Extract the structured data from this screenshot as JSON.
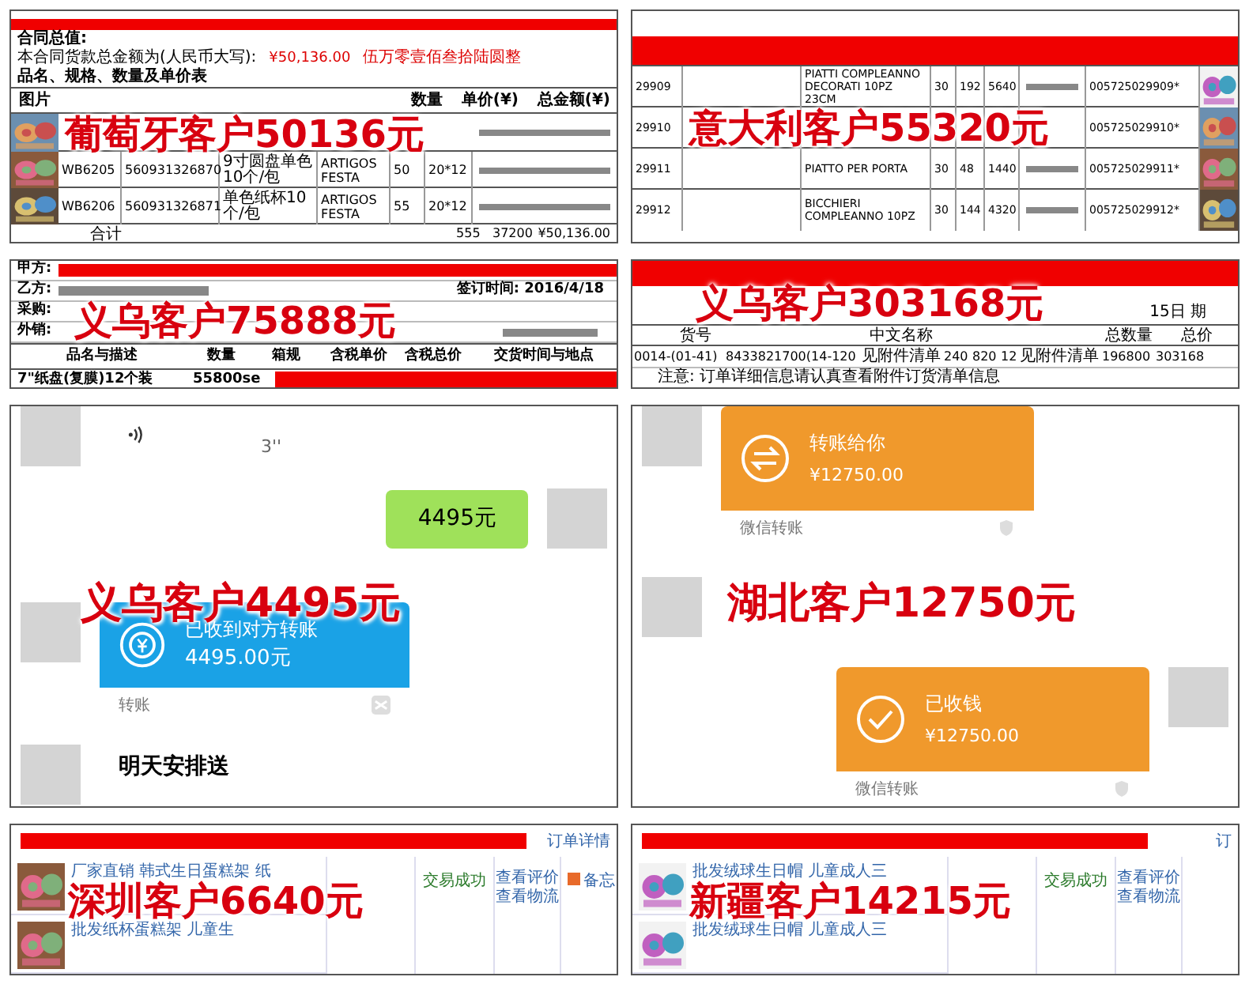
{
  "portugal": {
    "label": "葡萄牙客户50136元",
    "title": "合同总值:",
    "amount_line": "本合同货款总金额为(人民币大写):",
    "amount": "¥50,136.00",
    "amount_words": "伍万零壹佰叁拾陆圆整",
    "caption": "品名、规格、数量及单价表",
    "picture_heading": "图片",
    "columns": [
      "数量",
      "单价(¥)",
      "总金额(¥)"
    ],
    "rows": [
      {
        "code": "WB6205",
        "barcode": "560931326870",
        "name": "9寸圆盘单色10个/包",
        "brand": "ARTIGOS FESTA",
        "qty": "50",
        "size": "20*12"
      },
      {
        "code": "WB6206",
        "barcode": "560931326871",
        "name": "单色纸杯10个/包",
        "brand": "ARTIGOS FESTA",
        "qty": "55",
        "size": "20*12"
      }
    ],
    "total": {
      "label": "合计",
      "qty": "555",
      "sum": "37200",
      "amount": "¥50,136.00"
    }
  },
  "italy": {
    "label": "意大利客户55320元",
    "rows": [
      {
        "code": "29909",
        "name": "PIATTI COMPLEANNO DECORATI 10PZ 23CM",
        "qty": "30",
        "pcs": "192",
        "sum": "5640",
        "barcode": "005725029909*"
      },
      {
        "code": "29910",
        "barcode": "005725029910*"
      },
      {
        "code": "29911",
        "name": "PIATTO PER PORTA",
        "qty": "30",
        "pcs": "48",
        "sum": "1440",
        "barcode": "005725029911*"
      },
      {
        "code": "29912",
        "name": "BICCHIERI COMPLEANNO 10PZ",
        "qty": "30",
        "pcs": "144",
        "sum": "4320",
        "barcode": "005725029912*"
      }
    ]
  },
  "yiwu_contract": {
    "label": "义乌客户75888元",
    "party_a": "甲方:",
    "party_b": "乙方:",
    "date": "签订时间: 2016/4/18",
    "buyer": "采购:",
    "sales": "外销:",
    "columns": [
      "品名与描述",
      "数量",
      "箱规",
      "含税单价",
      "含税总价",
      "交货时间与地点"
    ],
    "item": "7\"纸盘(复膜)12个装",
    "quantity": "55800se"
  },
  "yiwu_order": {
    "label": "义乌客户303168元",
    "date": "15日 期",
    "columns": [
      "货号",
      "中文名称",
      "总数量",
      "总价"
    ],
    "row": [
      "0014-(01-41)",
      "8433821700(14-120",
      "见附件清单",
      "240",
      "820",
      "12",
      "见附件清单",
      "196800",
      "303168"
    ],
    "note": "注意: 订单详细信息请认真查看附件订货清单信息"
  },
  "yiwu_chat": {
    "label": "义乌客户4495元",
    "voice_length": "3''",
    "sent": "4495元",
    "transfer_title": "已收到对方转账",
    "transfer_amount": "4495.00元",
    "transfer_footer": "转账",
    "reply": "明天安排送"
  },
  "hubei_chat": {
    "label": "湖北客户12750元",
    "cards": [
      {
        "kind": "send",
        "title": "转账给你",
        "amount": "¥12750.00",
        "footer": "微信转账"
      },
      {
        "kind": "received",
        "title": "已收钱",
        "amount": "¥12750.00",
        "footer": "微信转账"
      }
    ]
  },
  "shenzhen": {
    "label": "深圳客户6640元",
    "detail_link": "订单详情",
    "products": [
      "厂家直销 韩式生日蛋糕架 纸",
      "批发纸杯蛋糕架 儿童生"
    ],
    "status": "交易成功",
    "links": [
      "查看评价",
      "查看物流"
    ],
    "memo": "备忘"
  },
  "xinjiang": {
    "label": "新疆客户14215元",
    "detail_link": "订",
    "products": [
      "批发绒球生日帽 儿童成人三",
      "批发绒球生日帽 儿童成人三"
    ],
    "status": "交易成功",
    "links": [
      "查看评价",
      "查看物流"
    ]
  }
}
